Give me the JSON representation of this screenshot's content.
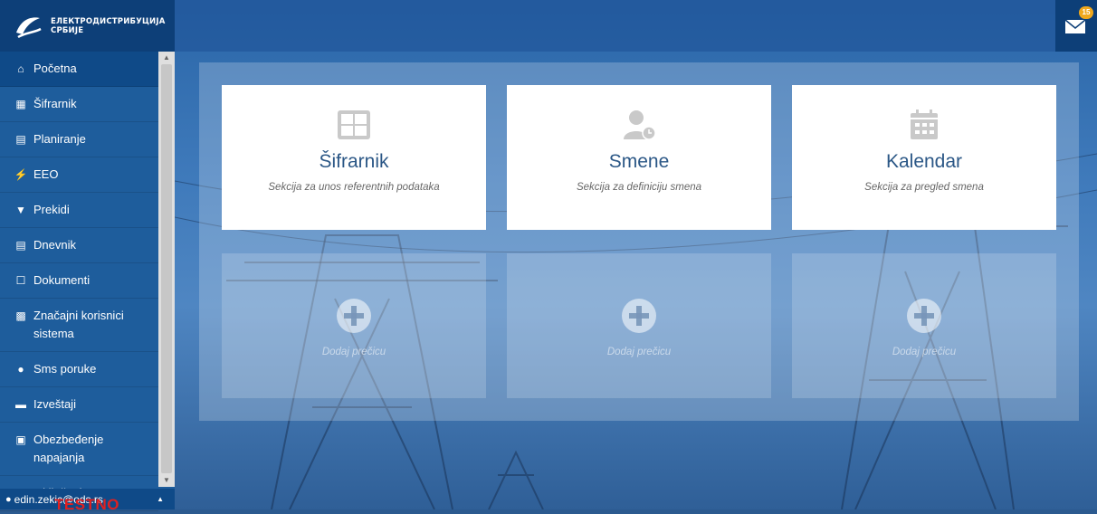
{
  "brand": {
    "line1": "ЕЛЕКТРОДИСТРИБУЦИЈА",
    "line2": "СРБИЈЕ"
  },
  "sidebar": {
    "items": [
      {
        "label": "Početna",
        "icon": "home-icon"
      },
      {
        "label": "Šifrarnik",
        "icon": "table-icon"
      },
      {
        "label": "Planiranje",
        "icon": "calendar-doc-icon"
      },
      {
        "label": "EEO",
        "icon": "bolt-icon"
      },
      {
        "label": "Prekidi",
        "icon": "plug-icon"
      },
      {
        "label": "Dnevnik",
        "icon": "journal-icon"
      },
      {
        "label": "Dokumenti",
        "icon": "document-icon"
      },
      {
        "label": "Značajni korisnici sistema",
        "icon": "building-icon"
      },
      {
        "label": "Sms poruke",
        "icon": "chat-icon"
      },
      {
        "label": "Izveštaji",
        "icon": "report-icon"
      },
      {
        "label": "Obezbeđenje napajanja",
        "icon": "file-image-icon"
      },
      {
        "label": "Isključenja",
        "icon": "power-icon"
      }
    ]
  },
  "user": {
    "email": "edin.zekic@ods.rs",
    "env_label": "TESTNO"
  },
  "notifications": {
    "count": "15"
  },
  "cards": [
    {
      "title": "Šifrarnik",
      "subtitle": "Sekcija za unos referentnih podataka",
      "icon": "grid-icon"
    },
    {
      "title": "Smene",
      "subtitle": "Sekcija za definiciju smena",
      "icon": "user-clock-icon"
    },
    {
      "title": "Kalendar",
      "subtitle": "Sekcija za pregled smena",
      "icon": "calendar-icon"
    }
  ],
  "shortcuts": [
    {
      "label": "Dodaj prečicu",
      "icon": "plus-circle-icon"
    },
    {
      "label": "Dodaj prečicu",
      "icon": "plus-circle-icon"
    },
    {
      "label": "Dodaj prečicu",
      "icon": "plus-circle-icon"
    }
  ],
  "colors": {
    "sidebar": "#1e5d9c",
    "brand_bar": "#0d3f78",
    "accent_text": "#2b5786",
    "badge": "#f0a81c",
    "test_label": "#e02020"
  }
}
